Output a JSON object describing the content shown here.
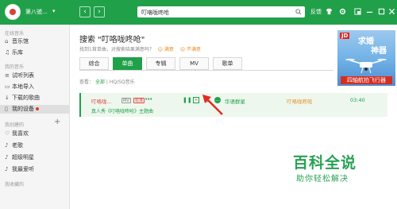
{
  "header": {
    "username": "第八號...",
    "user_dropdown": "▾",
    "back": "‹",
    "forward": "›",
    "search_value": "叮咯咙咚呛",
    "feedback": "反馈",
    "colors": {
      "bar": "#21a04a"
    }
  },
  "sidebar": {
    "online_title": "在线音乐",
    "online_items": [
      {
        "icon": "music-hall-icon",
        "label": "音乐馆"
      },
      {
        "icon": "library-icon",
        "label": "乐库"
      }
    ],
    "my_title": "我的音乐",
    "my_items": [
      {
        "icon": "list-icon",
        "label": "试听列表"
      },
      {
        "icon": "local-import-icon",
        "label": "本地导入"
      },
      {
        "icon": "download-icon",
        "label": "下载的歌曲"
      },
      {
        "icon": "device-icon",
        "label": "我的设备"
      }
    ],
    "created_title": "我创建的",
    "add": "+",
    "created_items": [
      {
        "icon": "heart-icon",
        "label": "我喜欢"
      },
      {
        "icon": "playlist-icon",
        "label": "老歌"
      },
      {
        "icon": "playlist-icon",
        "label": "超级明星"
      },
      {
        "icon": "playlist-icon",
        "label": "我最爱听"
      }
    ],
    "collected_title": "我收藏的"
  },
  "main": {
    "title": "搜索 \"叮咯咙咚呛\"",
    "result_text": "找到1首单曲，对搜索结果满意吗？",
    "satisfied": "满意",
    "unsatisfied": "不满意",
    "tabs": [
      "综合",
      "单曲",
      "专辑",
      "MV",
      "歌单"
    ],
    "active_tab": 1,
    "filter_label": "查看：",
    "filter_all": "全部",
    "filter_sep": "|",
    "filter_hq": "HQ/SQ音乐",
    "song": {
      "title": "叮咯咙...",
      "badge_mv": "MV",
      "badge_quality": "标准",
      "singer": "华语群星",
      "album": "叮咯咙咚呛",
      "duration": "03:40",
      "subline": "真人秀《叮咯咙咚呛》主题曲"
    }
  },
  "ad": {
    "brand": "JD",
    "line1": "求婚",
    "line2": "神器",
    "strip": "四轴航拍飞行器"
  },
  "watermark": {
    "line1": "百科全说",
    "line2": "助你轻松解决"
  }
}
